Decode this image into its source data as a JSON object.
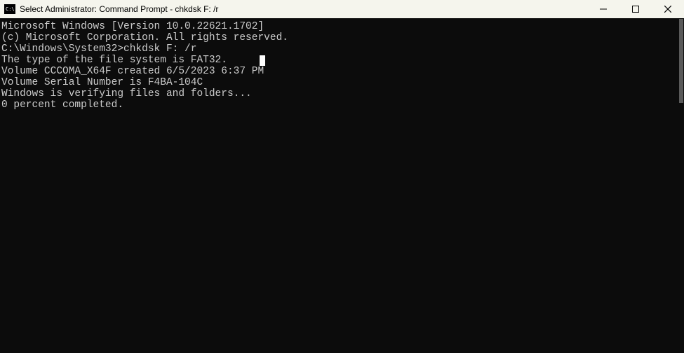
{
  "titlebar": {
    "icon_text": "C:\\.",
    "title": "Select Administrator: Command Prompt - chkdsk  F: /r"
  },
  "console": {
    "line1": "Microsoft Windows [Version 10.0.22621.1702]",
    "line2": "(c) Microsoft Corporation. All rights reserved.",
    "blank1": "",
    "prompt_line": "C:\\Windows\\System32>chkdsk F: /r",
    "line4": "The type of the file system is FAT32.",
    "line5": "Volume CCCOMA_X64F created 6/5/2023 6:37 PM",
    "line6": "Volume Serial Number is F4BA-104C",
    "line7": "Windows is verifying files and folders...",
    "line8": "0 percent completed."
  }
}
